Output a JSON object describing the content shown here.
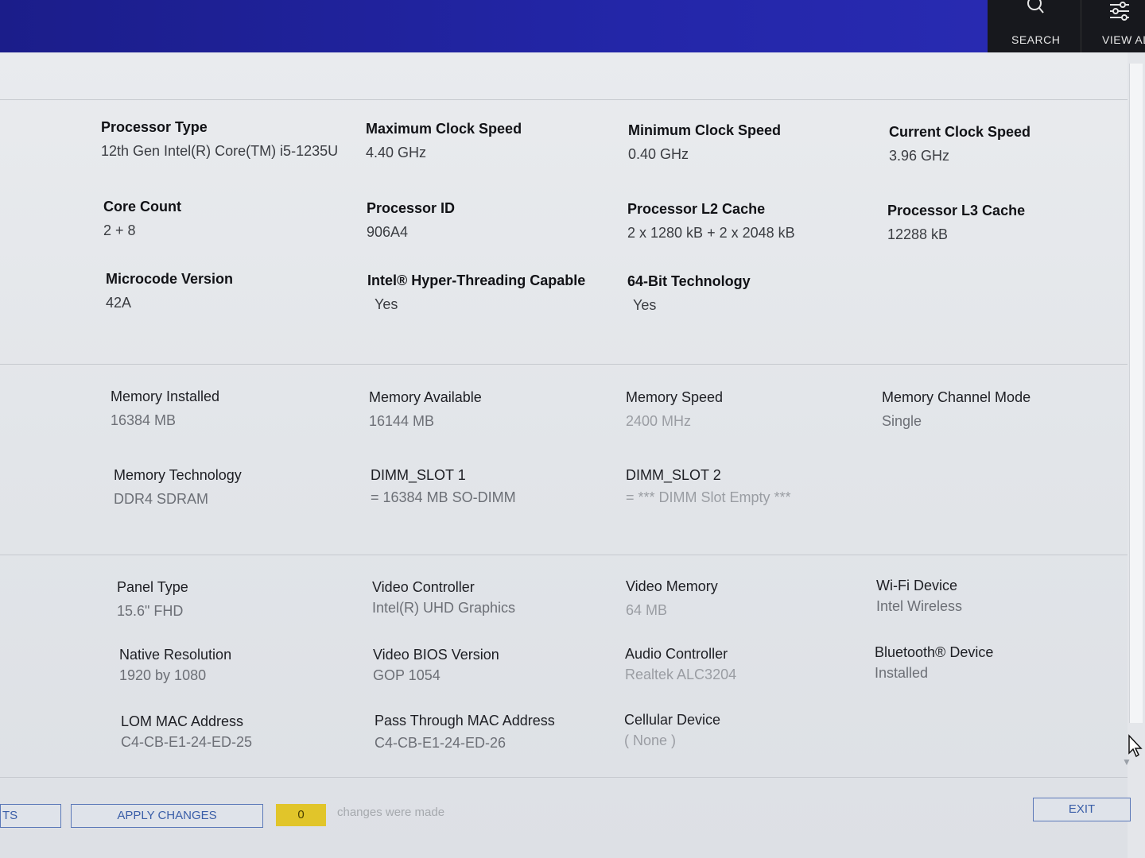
{
  "header": {
    "search_label": "SEARCH",
    "search_icon": "search-icon",
    "view_all_label": "VIEW AL",
    "view_all_icon": "filter-sliders-icon"
  },
  "processor": {
    "type": {
      "label": "Processor Type",
      "value": "12th Gen Intel(R) Core(TM) i5-1235U"
    },
    "max_clock": {
      "label": "Maximum Clock Speed",
      "value": "4.40 GHz"
    },
    "min_clock": {
      "label": "Minimum Clock Speed",
      "value": "0.40 GHz"
    },
    "current_clock": {
      "label": "Current Clock Speed",
      "value": "3.96 GHz"
    },
    "core_count": {
      "label": "Core Count",
      "value": "2 + 8"
    },
    "id": {
      "label": "Processor ID",
      "value": "906A4"
    },
    "l2_cache": {
      "label": "Processor L2 Cache",
      "value": "2 x 1280  kB + 2 x 2048  kB"
    },
    "l3_cache": {
      "label": "Processor L3 Cache",
      "value": "12288 kB"
    },
    "microcode": {
      "label": "Microcode Version",
      "value": "42A"
    },
    "hyperthreading": {
      "label": "Intel® Hyper-Threading Capable",
      "value": "Yes"
    },
    "bit64": {
      "label": "64-Bit Technology",
      "value": "Yes"
    }
  },
  "memory": {
    "installed": {
      "label": "Memory Installed",
      "value": "16384 MB"
    },
    "available": {
      "label": "Memory Available",
      "value": "16144 MB"
    },
    "speed": {
      "label": "Memory Speed",
      "value": "2400 MHz"
    },
    "channel_mode": {
      "label": "Memory Channel Mode",
      "value": "Single"
    },
    "technology": {
      "label": "Memory Technology",
      "value": "DDR4 SDRAM"
    },
    "dimm1": {
      "label": "DIMM_SLOT 1",
      "value": "= 16384 MB SO-DIMM"
    },
    "dimm2": {
      "label": "DIMM_SLOT 2",
      "value": "= *** DIMM Slot Empty ***"
    }
  },
  "devices": {
    "panel_type": {
      "label": "Panel Type",
      "value": "15.6\" FHD"
    },
    "video_controller": {
      "label": "Video Controller",
      "value": "Intel(R) UHD Graphics"
    },
    "video_memory": {
      "label": "Video Memory",
      "value": "64 MB"
    },
    "wifi": {
      "label": "Wi-Fi Device",
      "value": "Intel Wireless"
    },
    "native_res": {
      "label": "Native Resolution",
      "value": "1920 by 1080"
    },
    "video_bios": {
      "label": "Video BIOS Version",
      "value": "GOP 1054"
    },
    "audio": {
      "label": "Audio Controller",
      "value": "Realtek ALC3204"
    },
    "bluetooth": {
      "label": "Bluetooth® Device",
      "value": "Installed"
    },
    "lom_mac": {
      "label": "LOM MAC Address",
      "value": "C4-CB-E1-24-ED-25"
    },
    "passthrough_mac": {
      "label": "Pass Through MAC Address",
      "value": "C4-CB-E1-24-ED-26"
    },
    "cellular": {
      "label": "Cellular Device",
      "value": "( None )"
    }
  },
  "footer": {
    "left_button_label": "TS",
    "apply_label": "APPLY CHANGES",
    "changes_count": "0",
    "changes_text": "changes were made",
    "exit_label": "EXIT"
  }
}
